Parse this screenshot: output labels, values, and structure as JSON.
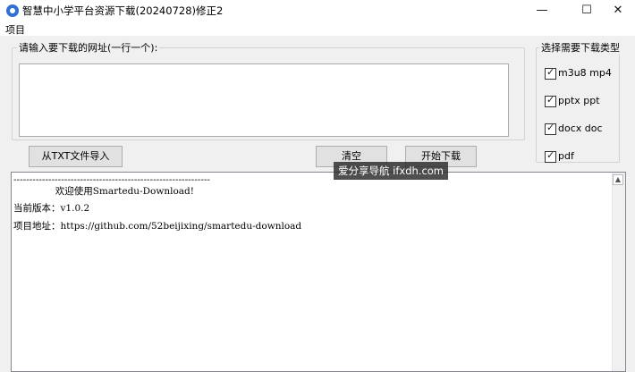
{
  "window": {
    "title": "智慧中小学平台资源下载(20240728)修正2",
    "minimize_glyph": "—",
    "maximize_glyph": "☐",
    "close_glyph": "✕"
  },
  "menu": {
    "project": "项目"
  },
  "url_group": {
    "label": "请输入要下载的网址(一行一个):",
    "value": ""
  },
  "type_group": {
    "label": "选择需要下载类型",
    "options": [
      "m3u8 mp4",
      "pptx ppt",
      "docx doc",
      "pdf"
    ]
  },
  "buttons": {
    "import": "从TXT文件导入",
    "clear": "清空",
    "start": "开始下载"
  },
  "log": {
    "lines": [
      "--------------------------------------------------------------",
      "              欢迎使用Smartedu-Download!",
      "当前版本：v1.0.2",
      "项目地址：https://github.com/52beijixing/smartedu-download"
    ]
  },
  "watermark": "爱分享导航 ifxdh.com",
  "colors": {
    "accent": "#2f6fd6"
  },
  "icons": {
    "app": "app-logo-icon",
    "scroll_up": "scroll-up-arrow-icon"
  }
}
